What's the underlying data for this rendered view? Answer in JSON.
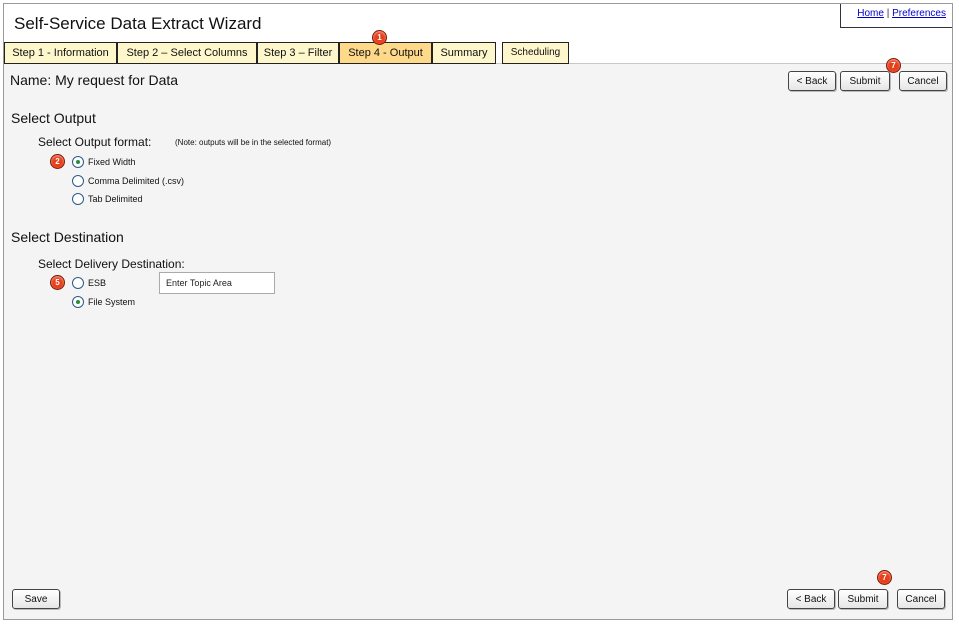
{
  "app": {
    "title": "Self-Service Data Extract Wizard"
  },
  "top_links": {
    "home": "Home",
    "separator": "|",
    "preferences": "Preferences"
  },
  "tabs": [
    {
      "label": "Step 1 - Information",
      "active": false
    },
    {
      "label": "Step 2 – Select Columns",
      "active": false
    },
    {
      "label": "Step 3 – Filter",
      "active": false
    },
    {
      "label": "Step 4 - Output",
      "active": true
    },
    {
      "label": "Summary",
      "active": false
    },
    {
      "label": "Scheduling",
      "active": false
    }
  ],
  "request": {
    "name": "Name: My request for Data"
  },
  "buttons": {
    "back": "< Back",
    "submit": "Submit",
    "cancel": "Cancel",
    "save": "Save"
  },
  "markers": {
    "tab": "1",
    "output": "2",
    "destination": "5",
    "submit_top": "7",
    "submit_bottom": "7"
  },
  "output": {
    "section_title": "Select Output",
    "format_label": "Select Output format:",
    "note": "(Note: outputs will be in the selected format)",
    "options": [
      {
        "label": "Fixed Width",
        "checked": true
      },
      {
        "label": "Comma Delimited (.csv)",
        "checked": false
      },
      {
        "label": "Tab Delimited",
        "checked": false
      }
    ]
  },
  "destination": {
    "section_title": "Select Destination",
    "delivery_label": "Select Delivery Destination:",
    "options": [
      {
        "label": "ESB",
        "checked": false
      },
      {
        "label": "File System",
        "checked": true
      }
    ],
    "topic_input": {
      "value": "Enter Topic Area"
    }
  },
  "colors": {
    "tab_bg": "#fff7cc",
    "tab_active_bg": "#ffd98a",
    "marker": "#e8401c",
    "radio_check": "#2e8b3a"
  }
}
